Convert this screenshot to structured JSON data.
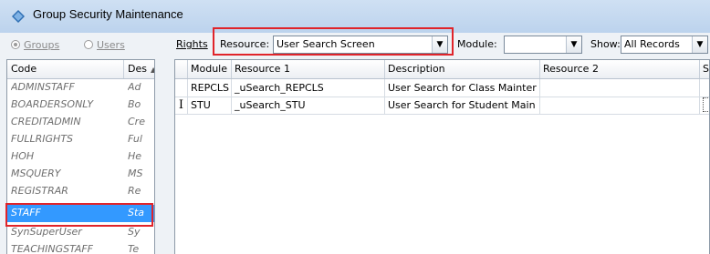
{
  "window": {
    "title": "Group Security Maintenance"
  },
  "toggle": {
    "groups_label": "Groups",
    "users_label": "Users",
    "selected": "groups"
  },
  "toolbar": {
    "rights_label": "Rights",
    "resource_label": "Resource:",
    "resource_value": "User Search Screen",
    "module_label": "Module:",
    "module_value": "",
    "show_label": "Show:",
    "show_value": "All Records"
  },
  "groups": {
    "columns": [
      "Code",
      "Des"
    ],
    "rows": [
      {
        "code": "ADMINSTAFF",
        "desc": "Ad"
      },
      {
        "code": "BOARDERSONLY",
        "desc": "Bo"
      },
      {
        "code": "CREDITADMIN",
        "desc": "Cre"
      },
      {
        "code": "FULLRIGHTS",
        "desc": "Ful"
      },
      {
        "code": "HOH",
        "desc": "He"
      },
      {
        "code": "MSQUERY",
        "desc": "MS"
      },
      {
        "code": "REGISTRAR",
        "desc": "Re"
      },
      {
        "code": "STAFF",
        "desc": "Sta"
      },
      {
        "code": "SynSuperUser",
        "desc": "Sy"
      },
      {
        "code": "TEACHINGSTAFF",
        "desc": "Te"
      }
    ],
    "selected_code": "STAFF"
  },
  "grid": {
    "columns": [
      "Module",
      "Resource 1",
      "Description",
      "Resource 2",
      "Select"
    ],
    "rows": [
      {
        "module": "REPCLS",
        "resource1": "_uSearch_REPCLS",
        "description": "User Search for Class Mainter",
        "resource2": "",
        "select": "✔"
      },
      {
        "module": "STU",
        "resource1": "_uSearch_STU",
        "description": "User Search for Student Main",
        "resource2": "",
        "select": "✔"
      }
    ]
  },
  "colors": {
    "highlight_border": "#e0242a",
    "selection": "#3399ff"
  }
}
